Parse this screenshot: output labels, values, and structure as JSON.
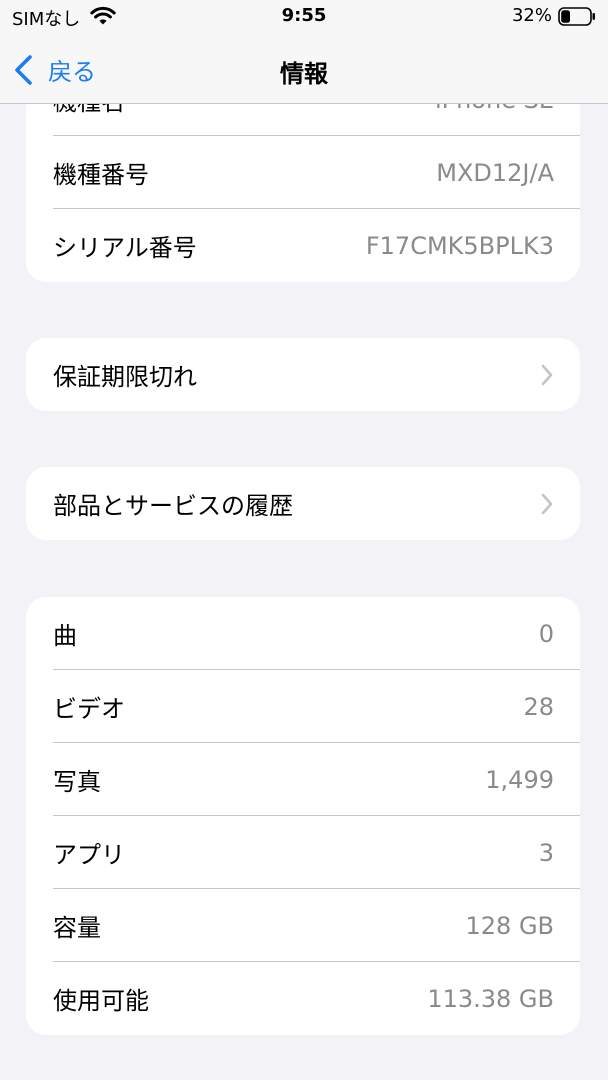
{
  "status_bar": {
    "carrier": "SIMなし",
    "time": "9:55",
    "battery_percent": "32%",
    "battery_level": 0.32,
    "icons": [
      "wifi-icon",
      "battery-icon"
    ]
  },
  "nav": {
    "back_label": "戻る",
    "title": "情報",
    "back_icon": "chevron-left-icon"
  },
  "device_info": {
    "rows": [
      {
        "label": "機種名",
        "value": "iPhone SE"
      },
      {
        "label": "機種番号",
        "value": "MXD12J/A"
      },
      {
        "label": "シリアル番号",
        "value": "F17CMK5BPLK3"
      }
    ]
  },
  "warranty": {
    "label": "保証期限切れ",
    "icon": "chevron-right-icon"
  },
  "parts_history": {
    "label": "部品とサービスの履歴",
    "icon": "chevron-right-icon"
  },
  "media_stats": {
    "rows": [
      {
        "label": "曲",
        "value": "0"
      },
      {
        "label": "ビデオ",
        "value": "28"
      },
      {
        "label": "写真",
        "value": "1,499"
      },
      {
        "label": "アプリ",
        "value": "3"
      },
      {
        "label": "容量",
        "value": "128 GB"
      },
      {
        "label": "使用可能",
        "value": "113.38 GB"
      }
    ]
  },
  "colors": {
    "accent": "#1a7cf4",
    "background": "#f2f2f7",
    "secondary_text": "#8a8a8e"
  }
}
